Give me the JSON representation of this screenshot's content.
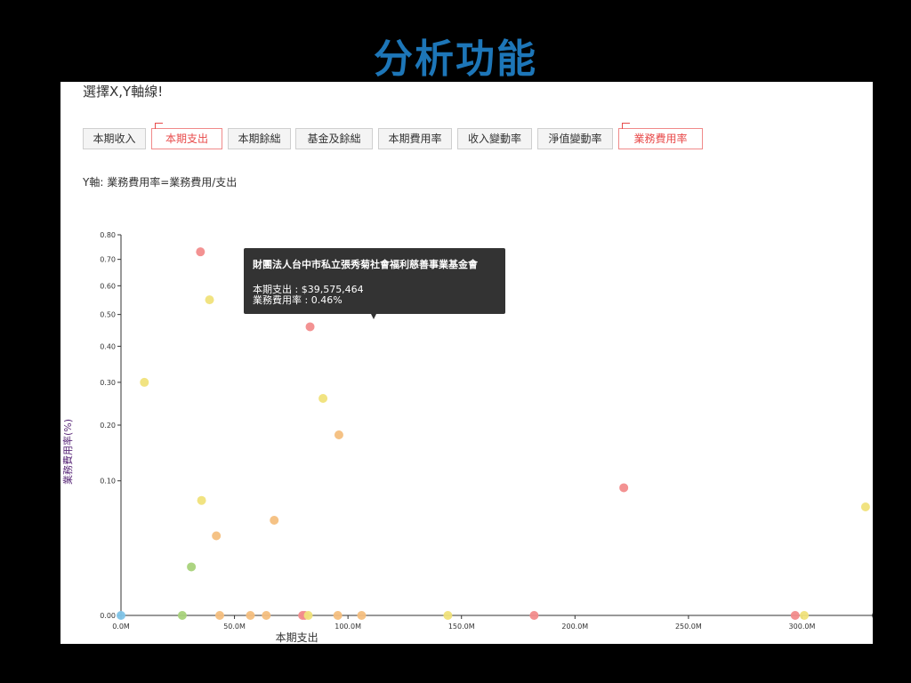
{
  "slide": {
    "title": "分析功能"
  },
  "panel": {
    "heading": "選擇X,Y軸線!",
    "x_buttons": [
      {
        "label": "本期收入",
        "selected": false
      },
      {
        "label": "本期支出",
        "selected": true
      },
      {
        "label": "本期餘絀",
        "selected": false
      },
      {
        "label": "基金及餘絀",
        "selected": false
      },
      {
        "label": "本期費用率",
        "selected": false
      },
      {
        "label": "收入變動率",
        "selected": false
      },
      {
        "label": "淨值變動率",
        "selected": false
      },
      {
        "label": "業務費用率",
        "selected": true
      }
    ],
    "y_info": "Y軸: 業務費用率=業務費用/支出"
  },
  "colors": {
    "title": "#1d76b8",
    "selected_border": "#f08a8a",
    "selected_text": "#e84b4b",
    "axis_label": "#5b2b7a",
    "point_palette": [
      "#f28c8c",
      "#f4bf7e",
      "#f0e17a",
      "#a8d27a",
      "#7fc4e8"
    ]
  },
  "tooltip": {
    "name": "財團法人台中市私立張秀菊社會福利慈善事業基金會",
    "line1": "本期支出 : $39,575,464",
    "line2": "業務費用率 : 0.46%"
  },
  "chart_data": {
    "type": "scatter",
    "xlabel": "本期支出",
    "ylabel": "業務費用率(%)",
    "x_unit": "M",
    "y_scale": "sqrt",
    "xlim": [
      0,
      330
    ],
    "ylim": [
      0,
      0.8
    ],
    "x_ticks": [
      0,
      50,
      100,
      150,
      200,
      250,
      300
    ],
    "x_tick_labels": [
      "0.0M",
      "50.0M",
      "100.0M",
      "150.0M",
      "200.0M",
      "250.0M",
      "300.0M"
    ],
    "y_ticks": [
      0,
      0.1,
      0.2,
      0.3,
      0.4,
      0.5,
      0.6,
      0.7,
      0.8
    ],
    "y_tick_labels": [
      "0.00",
      "0.10",
      "0.20",
      "0.30",
      "0.40",
      "0.50",
      "0.60",
      "0.70",
      "0.80"
    ],
    "points": [
      {
        "x": 0,
        "y": 0,
        "c": "#7fc4e8"
      },
      {
        "x": 10.3,
        "y": 0.3,
        "c": "#f0e17a"
      },
      {
        "x": 27,
        "y": 0,
        "c": "#a8d27a"
      },
      {
        "x": 31,
        "y": 0.013,
        "c": "#a8d27a"
      },
      {
        "x": 35,
        "y": 0.73,
        "c": "#f28c8c"
      },
      {
        "x": 35.5,
        "y": 0.073,
        "c": "#f0e17a"
      },
      {
        "x": 39,
        "y": 0.55,
        "c": "#f0e17a"
      },
      {
        "x": 42,
        "y": 0.035,
        "c": "#f4bf7e"
      },
      {
        "x": 43.5,
        "y": 0,
        "c": "#f4bf7e"
      },
      {
        "x": 57,
        "y": 0,
        "c": "#f4bf7e"
      },
      {
        "x": 64,
        "y": 0,
        "c": "#f4bf7e"
      },
      {
        "x": 67.5,
        "y": 0.05,
        "c": "#f4bf7e"
      },
      {
        "x": 80,
        "y": 0,
        "c": "#f28c8c"
      },
      {
        "x": 81,
        "y": 0,
        "c": "#f28c8c"
      },
      {
        "x": 82.5,
        "y": 0,
        "c": "#f0e17a"
      },
      {
        "x": 83.3,
        "y": 0.46,
        "c": "#f28c8c"
      },
      {
        "x": 89,
        "y": 0.26,
        "c": "#f0e17a"
      },
      {
        "x": 95.5,
        "y": 0,
        "c": "#f4bf7e"
      },
      {
        "x": 96,
        "y": 0.18,
        "c": "#f4bf7e"
      },
      {
        "x": 106,
        "y": 0,
        "c": "#f4bf7e"
      },
      {
        "x": 144,
        "y": 0,
        "c": "#f0e17a"
      },
      {
        "x": 182,
        "y": 0,
        "c": "#f28c8c"
      },
      {
        "x": 221.5,
        "y": 0.09,
        "c": "#f28c8c"
      },
      {
        "x": 297,
        "y": 0,
        "c": "#f28c8c"
      },
      {
        "x": 301,
        "y": 0,
        "c": "#f0e17a"
      },
      {
        "x": 328,
        "y": 0.065,
        "c": "#f0e17a"
      }
    ]
  }
}
